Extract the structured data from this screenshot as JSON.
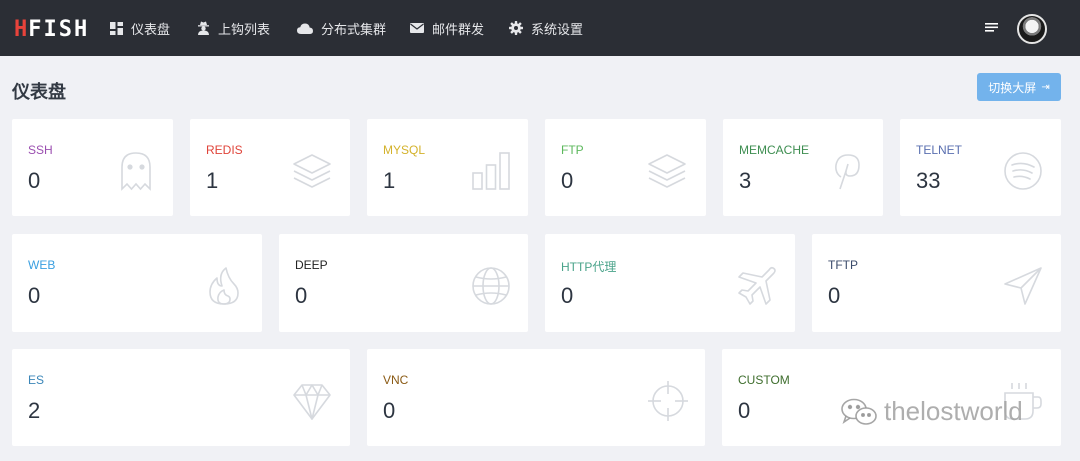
{
  "brand": {
    "prefix": "H",
    "rest": "FISH"
  },
  "nav": {
    "dashboard": "仪表盘",
    "bait_list": "上钩列表",
    "distributed": "分布式集群",
    "mail": "邮件群发",
    "settings": "系统设置"
  },
  "page": {
    "title": "仪表盘",
    "switch_label": "切换大屏"
  },
  "cards": {
    "ssh": {
      "label": "SSH",
      "count": "0",
      "color": "#9b4fb0",
      "icon": "ghost-icon"
    },
    "redis": {
      "label": "REDIS",
      "count": "1",
      "color": "#e0443a",
      "icon": "layers-icon"
    },
    "mysql": {
      "label": "MYSQL",
      "count": "1",
      "color": "#d4b22b",
      "icon": "bar-chart-icon"
    },
    "ftp": {
      "label": "FTP",
      "count": "0",
      "color": "#5cb85c",
      "icon": "layers-icon"
    },
    "memcache": {
      "label": "MEMCACHE",
      "count": "3",
      "color": "#3e8e51",
      "icon": "pinterest-icon"
    },
    "telnet": {
      "label": "TELNET",
      "count": "33",
      "color": "#5a6fb0",
      "icon": "spotify-icon"
    },
    "web": {
      "label": "WEB",
      "count": "0",
      "color": "#3a9fe0",
      "icon": "flame-icon"
    },
    "deep": {
      "label": "DEEP",
      "count": "0",
      "color": "#222222",
      "icon": "globe-icon"
    },
    "http": {
      "label": "HTTP代理",
      "count": "0",
      "color": "#4aa38a",
      "icon": "airplane-icon"
    },
    "tftp": {
      "label": "TFTP",
      "count": "0",
      "color": "#3a4a6a",
      "icon": "send-icon"
    },
    "es": {
      "label": "ES",
      "count": "2",
      "color": "#3b86b8",
      "icon": "diamond-icon"
    },
    "vnc": {
      "label": "VNC",
      "count": "0",
      "color": "#8a5a14",
      "icon": "crosshair-icon"
    },
    "custom": {
      "label": "CUSTOM",
      "count": "0",
      "color": "#3f6e2e",
      "icon": "coffee-icon"
    }
  },
  "watermark": "thelostworld"
}
